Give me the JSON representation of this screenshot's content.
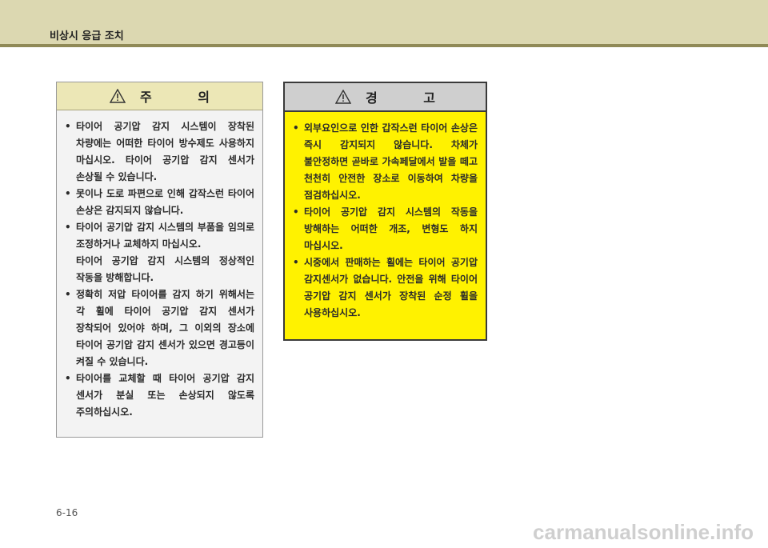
{
  "header": {
    "section_title": "비상시 응급 조치"
  },
  "caution": {
    "title": "주 의",
    "items": [
      "타이어 공기압 감지 시스템이 장착된 차량에는 어떠한 타이어 방수제도 사용하지 마십시오. 타이어 공기압 감지 센서가 손상될 수 있습니다.",
      "못이나 도로 파편으로 인해 갑작스런 타이어 손상은 감지되지 않습니다.",
      "타이어 공기압 감지 시스템의 부품을 임의로 조정하거나 교체하지 마십시오.",
      "정확히 저압 타이어를 감지 하기 위해서는 각 휠에 타이어 공기압 감지 센서가 장착되어 있어야 하며, 그 이외의 장소에 타이어 공기압 감지 센서가 있으면 경고등이 켜질 수 있습니다.",
      "타이어를 교체할 때 타이어 공기압 감지 센서가 분실 또는 손상되지 않도록 주의하십시오."
    ],
    "item3_sub": "타이어 공기압 감지 시스템의 정상적인 작동을 방해합니다."
  },
  "warning": {
    "title": "경 고",
    "items": [
      "외부요인으로 인한 갑작스런 타이어 손상은 즉시 감지되지 않습니다. 차체가 불안정하면 곧바로 가속페달에서 발을 떼고 천천히 안전한 장소로 이동하여 차량을 점검하십시오.",
      "타이어 공기압 감지 시스템의 작동을 방해하는 어떠한 개조, 변형도 하지 마십시오.",
      "시중에서 판매하는 휠에는 타이어 공기압 감지센서가 없습니다. 안전을 위해 타이어 공기압 감지 센서가 장착된 순정 휠을 사용하십시오."
    ]
  },
  "footer": {
    "page_number": "6-16",
    "watermark": "carmanualsonline.info"
  },
  "colors": {
    "header_band": "#dcd8b1",
    "header_rule": "#908a57",
    "caution_head": "#ece7b6",
    "warning_body": "#fff200",
    "warning_head": "#cfcfcf"
  },
  "icons": {
    "caution": "warning-triangle-icon",
    "warning": "warning-triangle-icon"
  }
}
